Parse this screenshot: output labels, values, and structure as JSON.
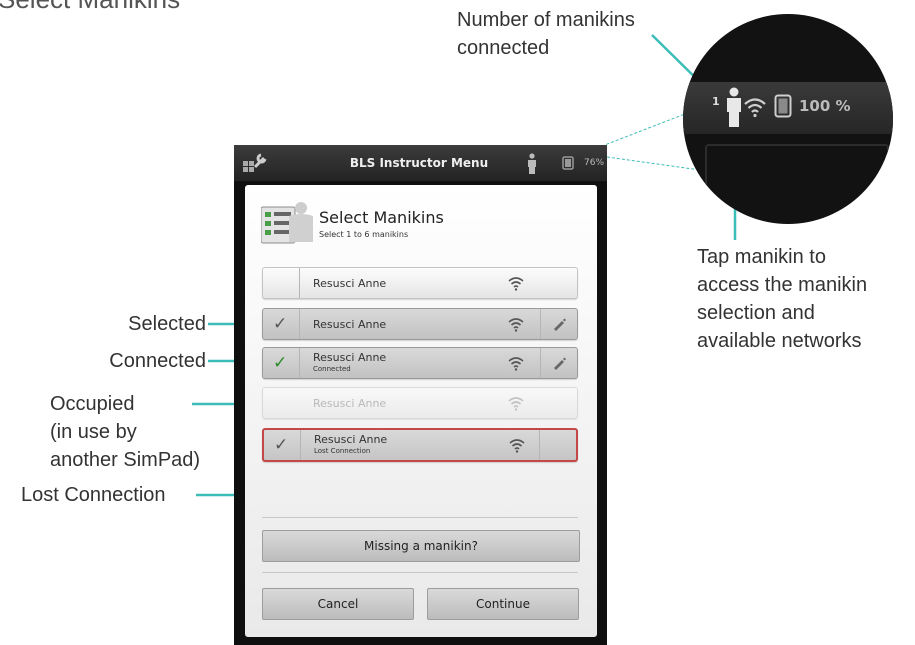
{
  "page_title": "Select Manikins",
  "callouts": {
    "number_connected": "Number of manikins\nconnected",
    "tap_manikin": "Tap manikin to\naccess the manikin\nselection and\navailable networks",
    "selected": "Selected",
    "connected": "Connected",
    "occupied": "Occupied\n(in use by\nanother SimPad)",
    "lost_connection": "Lost Connection"
  },
  "device": {
    "title": "BLS Instructor Menu",
    "battery": "76%",
    "dialog": {
      "title": "Select Manikins",
      "subtitle": "Select 1 to 6 manikins",
      "rows": [
        {
          "name": "Resusci Anne",
          "status": "",
          "state": "available",
          "edit_icon": false
        },
        {
          "name": "Resusci Anne",
          "status": "",
          "state": "selected",
          "edit_icon": true
        },
        {
          "name": "Resusci Anne",
          "status": "Connected",
          "state": "connected",
          "edit_icon": true
        },
        {
          "name": "Resusci Anne",
          "status": "",
          "state": "occupied",
          "edit_icon": false
        },
        {
          "name": "Resusci Anne",
          "status": "Lost Connection",
          "state": "lost",
          "edit_icon": false
        }
      ],
      "missing_label": "Missing a manikin?",
      "cancel_label": "Cancel",
      "continue_label": "Continue"
    }
  },
  "magnifier": {
    "manikin_count": "1",
    "battery": "100 %"
  },
  "colors": {
    "callout_line": "#3dbdb8",
    "lost_border": "#c44848",
    "connected_check": "#2a8a2a"
  }
}
